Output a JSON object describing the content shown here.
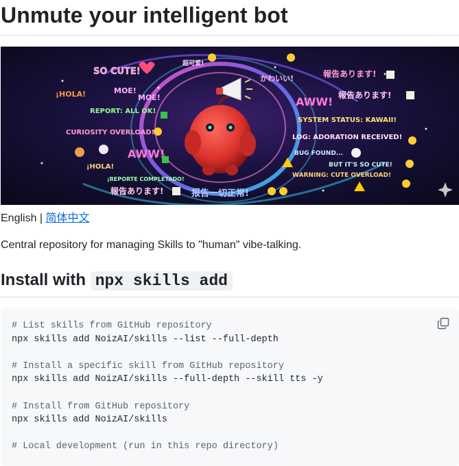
{
  "readme": {
    "title": "Unmute your intelligent bot",
    "banner": {
      "stickers": [
        "SO CUTE!",
        "超可爱!",
        "かわいい!",
        "報告あります!",
        "¡HOLA!",
        "MOE!",
        "MOE!",
        "報告あります!",
        "REPORT: ALL OK!",
        "AWW!",
        "CURIOSITY OVERLOAD!",
        "SYSTEM STATUS: KAWAII!",
        "LOG: ADORATION RECEIVED!",
        "AWW!",
        "¡HOLA!",
        "BUG FOUND...",
        "BUT IT'S SO CUTE!",
        "¡REPORTE COMPLETADO!",
        "WARNING: CUTE OVERLOAD!",
        "報告あります!",
        "报告一切正常!"
      ]
    },
    "lang": {
      "current": "English",
      "separator": " | ",
      "alt_link": "简体中文"
    },
    "description": "Central repository for managing Skills to \"human\" vibe-talking.",
    "install": {
      "heading_prefix": "Install with ",
      "heading_code": "npx skills add"
    },
    "code": {
      "lines": [
        {
          "text": "# List skills from GitHub repository",
          "kind": "comment"
        },
        {
          "text": "npx skills add NoizAI/skills --list --full-depth",
          "kind": "code"
        },
        {
          "text": "",
          "kind": "code"
        },
        {
          "text": "# Install a specific skill from GitHub repository",
          "kind": "comment"
        },
        {
          "text": "npx skills add NoizAI/skills --full-depth --skill tts -y",
          "kind": "code"
        },
        {
          "text": "",
          "kind": "code"
        },
        {
          "text": "# Install from GitHub repository",
          "kind": "comment"
        },
        {
          "text": "npx skills add NoizAI/skills",
          "kind": "code"
        },
        {
          "text": "",
          "kind": "code"
        },
        {
          "text": "# Local development (run in this repo directory)",
          "kind": "comment"
        }
      ],
      "copy_icon": "copy-icon"
    }
  }
}
